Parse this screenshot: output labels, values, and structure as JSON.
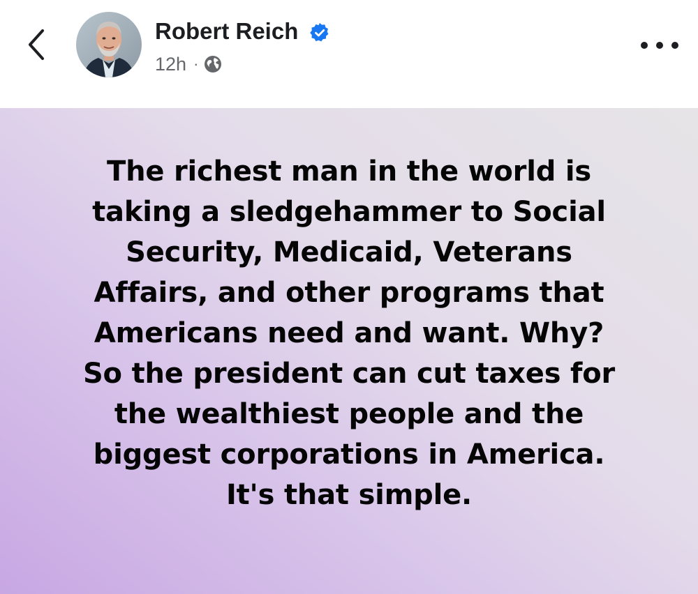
{
  "header": {
    "back_icon": "chevron-left-icon",
    "author_name": "Robert Reich",
    "verified_icon": "verified-badge-icon",
    "timestamp": "12h",
    "separator": "·",
    "audience_icon": "globe-icon",
    "more_icon": "more-horizontal-icon"
  },
  "post": {
    "lines": [
      "The richest man in the world is",
      "taking a sledgehammer to Social",
      "Security, Medicaid, Veterans",
      "Affairs, and other programs that",
      "Americans need and want. Why?",
      "So the president can cut taxes for",
      "the wealthiest people and the",
      "biggest corporations in America.",
      "It's that simple."
    ]
  },
  "colors": {
    "verified_blue": "#1877f2",
    "text_primary": "#1c1e21",
    "text_secondary": "#65676b",
    "background_gradient_start": "#c8a7e3",
    "background_gradient_end": "#e6e4e7"
  }
}
